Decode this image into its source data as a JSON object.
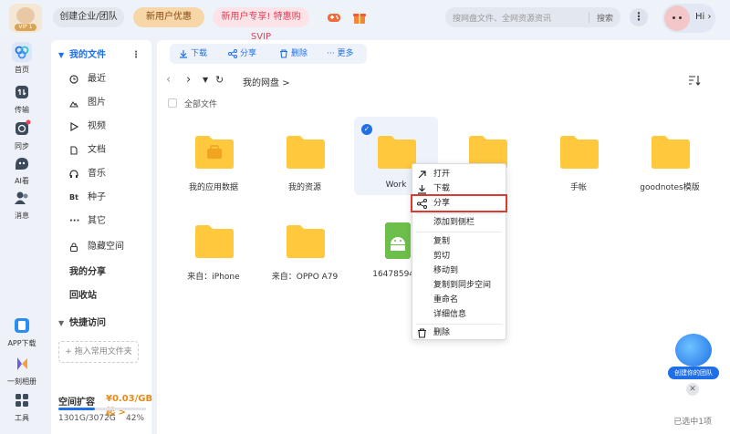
{
  "topbar": {
    "logo_badge": "VIP 1",
    "team_button": "创建企业/团队",
    "new_user_button": "新用户优惠",
    "svip_promo": "新用户专享! 特惠购SVIP",
    "search_placeholder": "搜网盘文件、全网资源资讯",
    "search_button": "搜索",
    "greeting": "Hi"
  },
  "rail": {
    "items": [
      {
        "label": "首页",
        "icon": "home-icon"
      },
      {
        "label": "传输",
        "icon": "transfer-icon"
      },
      {
        "label": "同步",
        "icon": "sync-icon"
      },
      {
        "label": "AI看",
        "icon": "ai-icon"
      },
      {
        "label": "消息",
        "icon": "message-icon"
      }
    ],
    "bottom_items": [
      {
        "label": "APP下载",
        "icon": "app-download-icon"
      },
      {
        "label": "一刻相册",
        "icon": "album-icon"
      },
      {
        "label": "工具",
        "icon": "tools-icon"
      }
    ]
  },
  "sidebar": {
    "my_files": "我的文件",
    "items": [
      {
        "label": "最近",
        "icon": "clock-icon"
      },
      {
        "label": "图片",
        "icon": "image-icon"
      },
      {
        "label": "视频",
        "icon": "video-icon"
      },
      {
        "label": "文档",
        "icon": "document-icon"
      },
      {
        "label": "音乐",
        "icon": "music-icon"
      },
      {
        "label": "种子",
        "icon": "bt-icon"
      },
      {
        "label": "其它",
        "icon": "more-dots-icon"
      },
      {
        "label": "隐藏空间",
        "icon": "lock-icon"
      }
    ],
    "bt_glyph": "Bt",
    "other_glyph": "···",
    "my_share": "我的分享",
    "recycle": "回收站",
    "quick_access": "快捷访问",
    "pin_placeholder": "+ 拖入常用文件夹",
    "quota_label": "空间扩容",
    "quota_promo": "¥0.03/GB起 >",
    "quota_used": "1301G/3072G",
    "quota_percent": "42%",
    "quota_fraction": 0.42
  },
  "toolbar": {
    "download": "下载",
    "share": "分享",
    "delete": "删除",
    "more": "更多"
  },
  "breadcrumb": {
    "root": "我的网盘",
    "arrow": ">"
  },
  "list": {
    "all_files": "全部文件",
    "files": [
      {
        "name": "我的应用数据",
        "type": "folder-app"
      },
      {
        "name": "我的资源",
        "type": "folder"
      },
      {
        "name": "Work",
        "type": "folder",
        "selected": true
      },
      {
        "name": "",
        "type": "folder"
      },
      {
        "name": "手帐",
        "type": "folder"
      },
      {
        "name": "goodnotes模版",
        "type": "folder"
      },
      {
        "name": "来自：iPhone",
        "type": "folder"
      },
      {
        "name": "来自：OPPO A79",
        "type": "folder"
      },
      {
        "name": "164785943",
        "type": "apk"
      }
    ]
  },
  "context_menu": {
    "items": [
      "打开",
      "下载",
      "分享",
      "添加到侧栏",
      "复制",
      "剪切",
      "移动到",
      "复制到同步空间",
      "重命名",
      "详细信息",
      "删除"
    ],
    "highlighted": "分享"
  },
  "promo_float": {
    "label": "创建你的团队"
  },
  "status": {
    "selection": "已选中1项"
  },
  "colors": {
    "accent": "#1f6fe6",
    "folder": "#ffc83d",
    "highlight_border": "#d93a32"
  }
}
